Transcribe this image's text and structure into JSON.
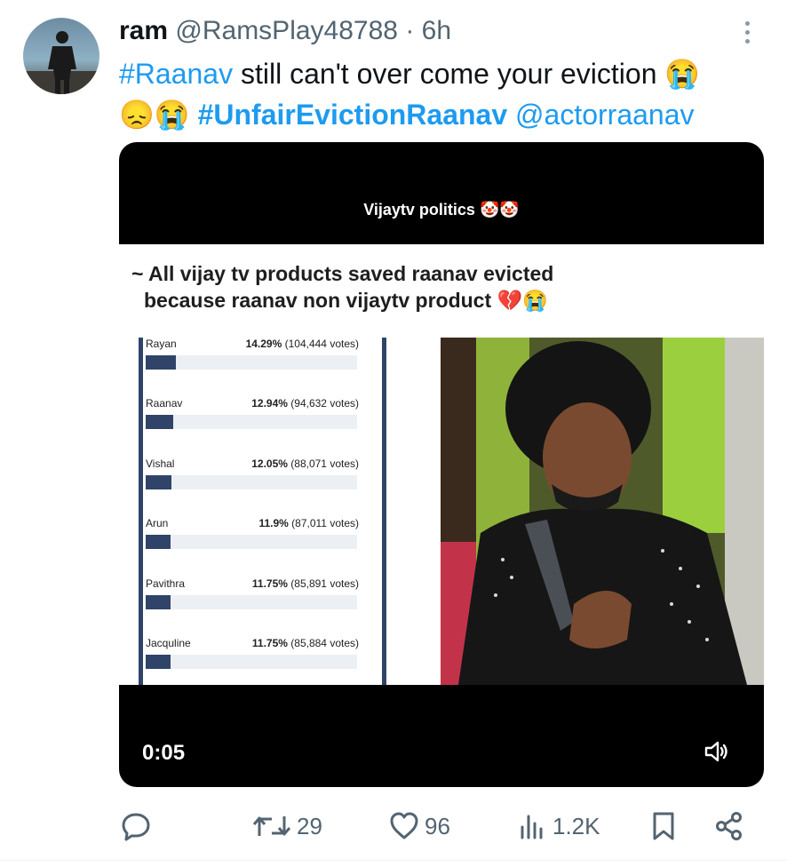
{
  "tweet": {
    "display_name": "ram",
    "handle": "@RamsPlay48788",
    "separator": "·",
    "time_ago": "6h",
    "text_hashtag_1": "#Raanav",
    "text_line": " still can't over come your eviction ",
    "emoji_sob": "😭",
    "emoji_disappointed": "😞",
    "hashtag_2": "#UnfairEvictionRaanav",
    "mention": "@actorraanav"
  },
  "video": {
    "top_title": "Vijaytv politics 🤡🤡",
    "caption_line_1": "~ All vijay tv products saved raanav evicted",
    "caption_line_2": "because raanav non vijaytv product 💔😭",
    "timestamp": "0:05",
    "volume_icon": "volume-icon",
    "poll": [
      {
        "name": "Rayan",
        "percent": "14.29%",
        "votes": "(104,444 votes)",
        "fraction": 0.1429
      },
      {
        "name": "Raanav",
        "percent": "12.94%",
        "votes": "(94,632 votes)",
        "fraction": 0.1294
      },
      {
        "name": "Vishal",
        "percent": "12.05%",
        "votes": "(88,071 votes)",
        "fraction": 0.1205
      },
      {
        "name": "Arun",
        "percent": "11.9%",
        "votes": "(87,011 votes)",
        "fraction": 0.119
      },
      {
        "name": "Pavithra",
        "percent": "11.75%",
        "votes": "(85,891 votes)",
        "fraction": 0.1175
      },
      {
        "name": "Jacquline",
        "percent": "11.75%",
        "votes": "(85,884 votes)",
        "fraction": 0.1175
      }
    ]
  },
  "actions": {
    "reply_icon": "reply-icon",
    "retweet_icon": "retweet-icon",
    "retweet_count": "29",
    "like_icon": "heart-icon",
    "like_count": "96",
    "views_icon": "views-icon",
    "views_count": "1.2K",
    "bookmark_icon": "bookmark-icon",
    "share_icon": "share-icon"
  },
  "colors": {
    "link": "#1d9bf0",
    "secondary_text": "#536471",
    "poll_bar": "#2f4468"
  }
}
